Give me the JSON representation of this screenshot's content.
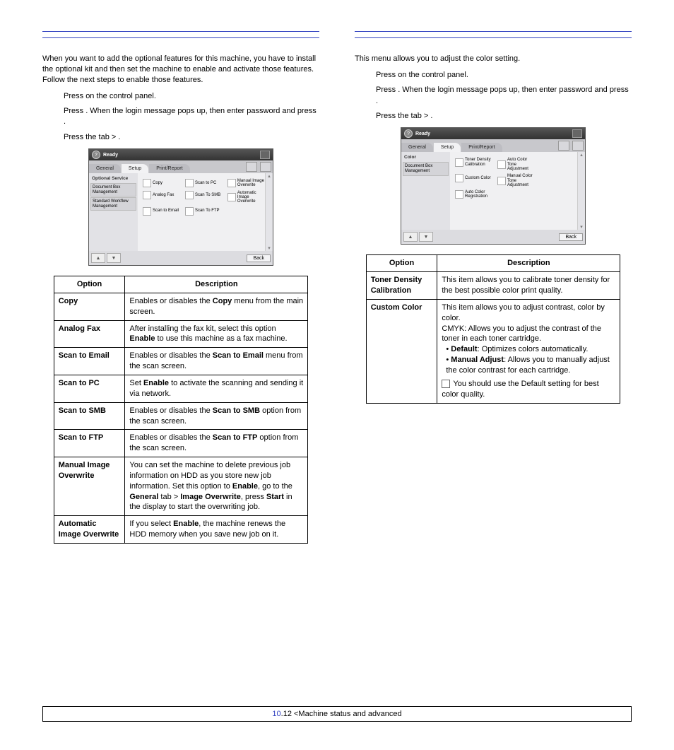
{
  "left": {
    "intro": "When you want to add the optional features for this machine, you have to install the optional kit and then set the machine to enable and activate those features. Follow the next steps to enable those features.",
    "step1_a": "Press ",
    "step1_b": " on the control panel.",
    "step2_a": "Press ",
    "step2_b": ". When the login message pops up, then enter password and press ",
    "step2_c": ".",
    "step3_a": "Press the ",
    "step3_b": " tab > ",
    "step3_c": ".",
    "panel": {
      "ready": "Ready",
      "tab1": "General",
      "tab2": "Setup",
      "tab3": "Print/Report",
      "side_hdr": "Optional Service",
      "side1": "Document Box Management",
      "side2": "Standard Workflow Management",
      "c_copy": "Copy",
      "c_scanpc": "Scan to PC",
      "c_manimg": "Manual Image Overwrite",
      "c_afax": "Analog Fax",
      "c_smb": "Scan To SMB",
      "c_autoimg": "Automatic Image Overwrite",
      "c_email": "Scan to Email",
      "c_ftp": "Scan To FTP",
      "back": "Back"
    },
    "table": {
      "h1": "Option",
      "h2": "Description",
      "r1o": "Copy",
      "r1d_a": "Enables or disables the ",
      "r1d_bold": "Copy",
      "r1d_b": " menu from the main screen.",
      "r2o": "Analog Fax",
      "r2d_a": "After installing the fax kit, select this option ",
      "r2d_bold": "Enable",
      "r2d_b": " to use this machine as a fax machine.",
      "r3o": "Scan to Email",
      "r3d_a": "Enables or disables the ",
      "r3d_bold": "Scan to Email",
      "r3d_b": " menu from the scan screen.",
      "r4o": "Scan to PC",
      "r4d_a": "Set ",
      "r4d_bold": "Enable",
      "r4d_b": " to activate the scanning and sending it via network.",
      "r5o": "Scan to SMB",
      "r5d_a": "Enables or disables the ",
      "r5d_bold": "Scan to SMB",
      "r5d_b": " option from the scan screen.",
      "r6o": "Scan to FTP",
      "r6d_a": "Enables or disables the ",
      "r6d_bold": "Scan to FTP",
      "r6d_b": " option from the scan screen.",
      "r7o": "Manual Image Overwrite",
      "r7d_a": "You can set the machine to delete previous job information on HDD as you store new job information. Set this option to ",
      "r7d_bold1": "Enable",
      "r7d_b": ", go to the ",
      "r7d_bold2": "General",
      "r7d_c": " tab > ",
      "r7d_bold3": "Image Overwrite",
      "r7d_d": ", press ",
      "r7d_bold4": "Start",
      "r7d_e": " in the display to start the overwriting job.",
      "r8o": "Automatic Image Overwrite",
      "r8d_a": "If you select ",
      "r8d_bold": "Enable",
      "r8d_b": ", the machine renews the HDD memory when you save new job on it."
    }
  },
  "right": {
    "intro": "This menu allows you to adjust the color setting.",
    "step1_a": "Press ",
    "step1_b": " on the control panel.",
    "step2_a": "Press ",
    "step2_b": ". When the login message pops up, then enter password and press ",
    "step2_c": ".",
    "step3_a": "Press the ",
    "step3_b": " tab > ",
    "step3_c": ".",
    "panel": {
      "ready": "Ready",
      "tab1": "General",
      "tab2": "Setup",
      "tab3": "Print/Report",
      "side_hdr": "Color",
      "side1": "Document Box Management",
      "c1": "Toner Density Calibration",
      "c2": "Auto Color Tone Adjustment",
      "c3": "Custom Color",
      "c4": "Manual Color Tone Adjustment",
      "c5": "Auto Color Registration",
      "back": "Back"
    },
    "table": {
      "h1": "Option",
      "h2": "Description",
      "r1o": "Toner Density Calibration",
      "r1d": "This item allows you to calibrate toner density for the best possible color print quality.",
      "r2o": "Custom Color",
      "r2d_intro": "This item allows you to adjust contrast, color by color.",
      "r2d_cmyk": "CMYK: Allows you to adjust the contrast of the toner in each toner cartridge.",
      "r2d_b1_bold": "Default",
      "r2d_b1": ": Optimizes colors automatically.",
      "r2d_b2_bold": "Manual Adjust",
      "r2d_b2": ": Allows you to manually adjust the color contrast for each cartridge.",
      "r2d_note": "You should use the Default setting for best color quality."
    }
  },
  "footer": {
    "page": "10",
    "dot": ".12",
    "crumb": " <Machine status and advanced"
  }
}
